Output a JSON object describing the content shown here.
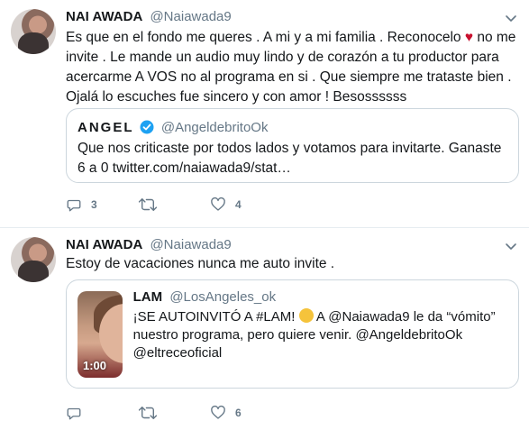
{
  "tweets": [
    {
      "name": "NAI AWADA",
      "handle": "@Naiawada9",
      "text_part1": "Es que en el fondo me queres . A mi y a mi familia . Reconocelo ",
      "heart": "♥",
      "text_part2": " no me invite . Le mande un audio muy lindo y de corazón a tu productor para acercarme A VOS no al programa en si . Que siempre me trataste bien . Ojalá lo escuches fue sincero y con amor ! Besossssss",
      "quote": {
        "name": "ANGEL",
        "handle": "@AngeldebritoOk",
        "text": "Que nos criticaste por todos lados y votamos para invitarte. Ganaste 6 a 0 twitter.com/naiawada9/stat…"
      },
      "replies": "3",
      "retweets": "",
      "likes": "4"
    },
    {
      "name": "NAI AWADA",
      "handle": "@Naiawada9",
      "text": "Estoy de vacaciones nunca me auto invite .",
      "quote": {
        "name": "LAM",
        "handle": "@LosAngeles_ok",
        "text_part1": "¡SE AUTOINVITÓ A #LAM! ",
        "text_part2": " A @Naiawada9 le da “vómito” nuestro programa, pero quiere venir. @AngeldebritoOk @eltreceoficial",
        "video_duration": "1:00"
      },
      "replies": "",
      "retweets": "",
      "likes": "6"
    }
  ],
  "colors": {
    "text": "#14171a",
    "secondary": "#657786",
    "border": "#e6ecf0",
    "verified": "#1da1f2",
    "heart": "#c8102e"
  },
  "icons": [
    "chevron-down-icon",
    "reply-icon",
    "retweet-icon",
    "like-icon",
    "verified-icon",
    "thinking-face-emoji"
  ]
}
